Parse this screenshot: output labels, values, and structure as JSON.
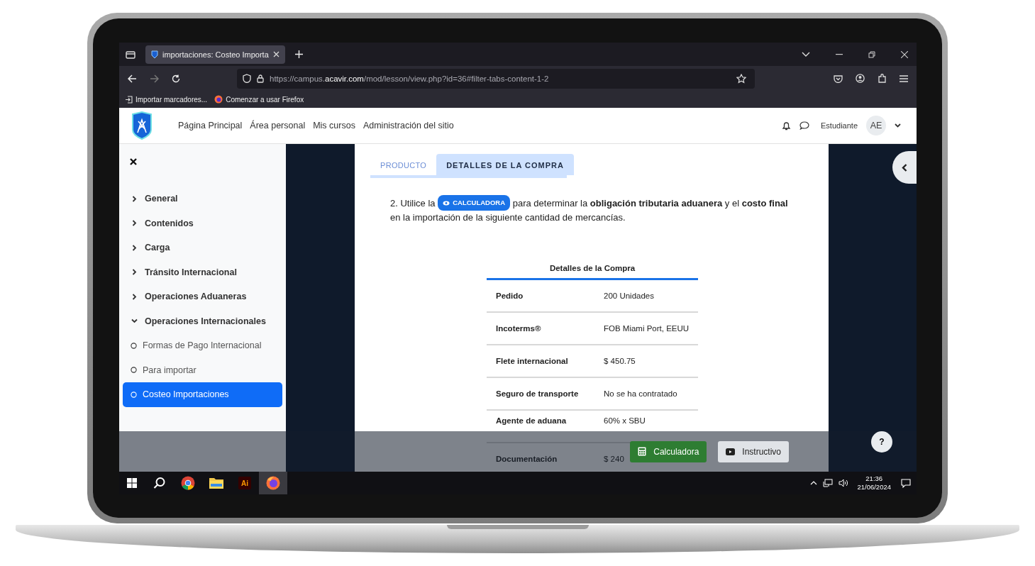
{
  "browser": {
    "tab_title": "importaciones: Costeo Importa",
    "url_prefix": "https://campus.",
    "url_domain": "acavir.com",
    "url_path": "/mod/lesson/view.php?id=36#filter-tabs-content-1-2",
    "bookmarks": [
      {
        "kind": "import",
        "label": "Importar marcadores..."
      },
      {
        "kind": "firefox",
        "label": "Comenzar a usar Firefox"
      }
    ]
  },
  "site_nav": {
    "items": [
      "Página Principal",
      "Área personal",
      "Mis cursos",
      "Administración del sitio"
    ],
    "user_name": "Estudiante",
    "avatar": "AE"
  },
  "sidebar": {
    "sections": [
      {
        "label": "General",
        "expanded": false
      },
      {
        "label": "Contenidos",
        "expanded": false
      },
      {
        "label": "Carga",
        "expanded": false
      },
      {
        "label": "Tránsito Internacional",
        "expanded": false
      },
      {
        "label": "Operaciones Aduaneras",
        "expanded": false
      },
      {
        "label": "Operaciones Internacionales",
        "expanded": true,
        "children": [
          {
            "label": "Formas de Pago Internacional",
            "selected": false
          },
          {
            "label": "Para importar",
            "selected": false
          },
          {
            "label": "Costeo Importaciones",
            "selected": true
          }
        ]
      }
    ]
  },
  "tabs": [
    {
      "label": "PRODUCTO",
      "selected": false
    },
    {
      "label": "DETALLES DE LA COMPRA",
      "selected": true
    }
  ],
  "instruction": {
    "number": "2.",
    "before": "Utilice la",
    "badge": "CALCULADORA",
    "after": "para determinar la **obligación tributaria aduanera** y el **costo final** en la importación de la siguiente cantidad de mercancías."
  },
  "table": {
    "title": "Detalles de la Compra",
    "rows": [
      {
        "label": "Pedido",
        "value": "200 Unidades"
      },
      {
        "label": "Incoterms®",
        "value": "FOB Miami Port, EEUU"
      },
      {
        "label": "Flete internacional",
        "value": "$ 450.75"
      },
      {
        "label": "Seguro de transporte",
        "value": "No se ha contratado"
      },
      {
        "label": "Agente de aduana",
        "value": "60% x SBU"
      },
      {
        "label": "Documentación",
        "value": "$ 240"
      }
    ]
  },
  "footer": {
    "buttons": [
      {
        "kind": "calculator",
        "label": "Calculadora"
      },
      {
        "kind": "video",
        "label": "Instructivo"
      }
    ],
    "help": "?"
  },
  "taskbar": {
    "apps": [
      {
        "kind": "search",
        "selected": false
      },
      {
        "kind": "chrome",
        "selected": false
      },
      {
        "kind": "files",
        "selected": false
      },
      {
        "kind": "illustrator",
        "label": "Ai",
        "selected": false
      },
      {
        "kind": "firefox",
        "selected": true
      }
    ],
    "time": "21:36",
    "date": "21/06/2024"
  }
}
